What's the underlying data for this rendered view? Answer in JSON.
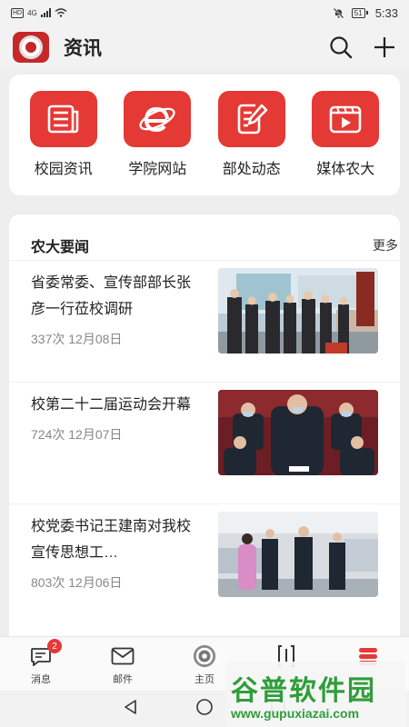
{
  "status_bar": {
    "network": "4G",
    "hd": "HD",
    "battery": "51",
    "time": "5:33"
  },
  "header": {
    "title": "资讯"
  },
  "quick_links": [
    {
      "label": "校园资讯",
      "icon": "newspaper-icon"
    },
    {
      "label": "学院网站",
      "icon": "browser-e-icon"
    },
    {
      "label": "部处动态",
      "icon": "edit-doc-icon"
    },
    {
      "label": "媒体农大",
      "icon": "video-play-icon"
    }
  ],
  "news_section": {
    "title": "农大要闻",
    "more_label": "更多",
    "items": [
      {
        "title": "省委常委、宣传部部长张彦一行莅校调研",
        "views": "337次",
        "date": "12月08日"
      },
      {
        "title": "校第二十二届运动会开幕",
        "views": "724次",
        "date": "12月07日"
      },
      {
        "title": "校党委书记王建南对我校宣传思想工…",
        "views": "803次",
        "date": "12月06日"
      }
    ]
  },
  "tabs": [
    {
      "label": "消息",
      "badge": "2"
    },
    {
      "label": "邮件"
    },
    {
      "label": "主页"
    },
    {
      "label": ""
    },
    {
      "label": ""
    }
  ],
  "watermark": {
    "text": "谷普软件园",
    "url": "www.gupuxiazai.com"
  },
  "colors": {
    "accent": "#e53935",
    "brand": "#c62828",
    "watermark": "#2e9e3a"
  }
}
